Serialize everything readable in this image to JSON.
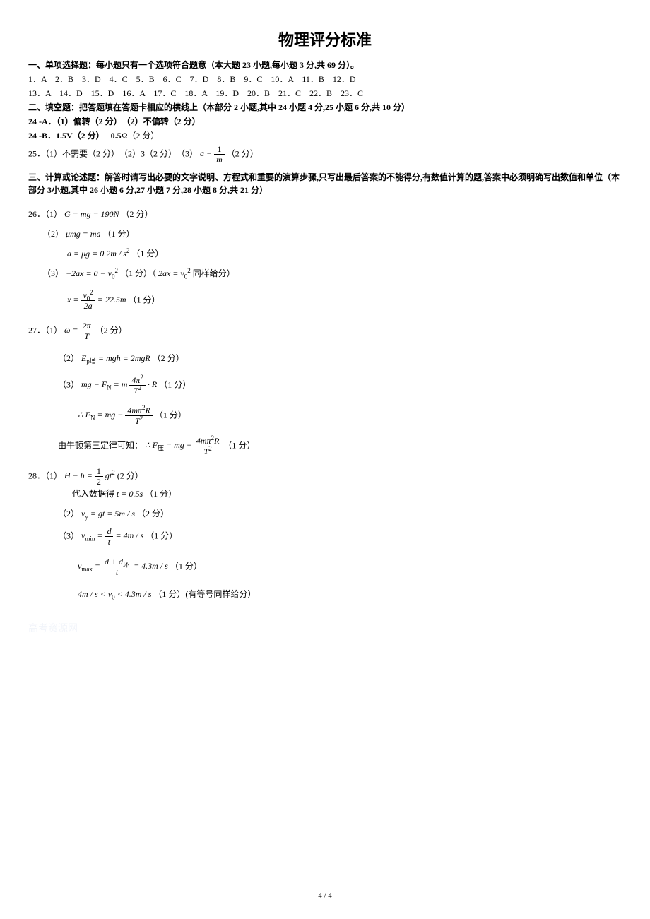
{
  "title": "物理评分标准",
  "section1": {
    "header": "一、单项选择题：每小题只有一个选项符合题意（本大题 23 小题,每小题 3 分,共 69 分）。",
    "row1": "1．A　2．B　3．D　4．C　5．B　6．C　7．D　8．B　9．C　10．A　11．B　12．D",
    "row2": "13．A　14．D　15．D　16．A　17．C　18．A　19．D　20．B　21．C　22．B　23．C"
  },
  "section2": {
    "header": "二、填空题：把答题填在答题卡相应的横线上（本部分 2 小题,其中 24 小题 4 分,25 小题 6 分,共 10 分）",
    "l24a": "24 -A．（1）偏转（2 分）　（2）不偏转（2 分）",
    "l24b_prefix": "24 -B．1.5V（2 分）　 0.5",
    "l24b_suffix": "（2 分）",
    "l25_prefix": "25．（1）不需要（2 分）　（2）3（2 分）　（3）",
    "l25_suffix": "（2 分）"
  },
  "section3": {
    "header": "三、计算或论述题：解答时请写出必要的文字说明、方程式和重要的演算步骤,只写出最后答案的不能得分,有数值计算的题,答案中必须明确写出数值和单位（本部分 3小题,其中 26 小题 6 分,27 小题 7 分,28 小题 8 分,共 21 分）"
  },
  "q26": {
    "p1_pre": "26．（1）",
    "p1_eq": "G = mg = 190N",
    "p1_pts": "（2 分）",
    "p2_pre": "（2）",
    "p2_eq": "μmg = ma",
    "p2_pts": "（1 分）",
    "p2b_eq_pre": "a = μg = 0.2m / s",
    "p2b_pts": "（1 分）",
    "p3_pre": "（3）",
    "p3_eq1_pre": "−2ax = 0 − v",
    "p3_pts1": "（1 分）（",
    "p3_eq2_pre": "2ax = v",
    "p3_suffix": "同样给分）",
    "p3b_pre": "x =",
    "p3b_frac_top": "v",
    "p3b_frac_bot": "2a",
    "p3b_eq_post": "= 22.5m",
    "p3b_pts": "（1 分）"
  },
  "q27": {
    "p1_pre": "27．（1）",
    "p1_eq_pre": "ω =",
    "p1_frac_top": "2π",
    "p1_frac_bot": "T",
    "p1_pts": "（2 分）",
    "p2_pre": "（2）",
    "p2_eq": "E",
    "p2_sub": "p增",
    "p2_eq2": " = mgh = 2mgR",
    "p2_pts": "（2 分）",
    "p3_pre": "（3）",
    "p3_eq_pre": "mg − F",
    "p3_sub": "N",
    "p3_eq_mid": " = m",
    "p3_frac_top": "4π",
    "p3_frac_bot": "T",
    "p3_eq_post": "· R",
    "p3_pts": "（1 分）",
    "p3b_pre": "∴ F",
    "p3b_sub": "N",
    "p3b_eq_mid": " = mg −",
    "p3b_frac_top": "4mπ",
    "p3b_frac_top2": "R",
    "p3b_frac_bot": "T",
    "p3b_pts": "（1 分）",
    "p3c_text": "由牛顿第三定律可知：",
    "p3c_eq_pre": "∴ F",
    "p3c_sub": "压",
    "p3c_eq_mid": " = mg −",
    "p3c_pts": "（1 分）"
  },
  "q28": {
    "p1_pre": "28．（1）",
    "p1_eq_pre": "H − h =",
    "p1_frac_top": "1",
    "p1_frac_bot": "2",
    "p1_eq_post": "gt",
    "p1_pts": "(2 分）",
    "p1b_text": "代入数据得",
    "p1b_eq": "t = 0.5s",
    "p1b_pts": "（1 分）",
    "p2_pre": "（2）",
    "p2_eq_pre": "v",
    "p2_sub": "y",
    "p2_eq_post": " = gt = 5m / s",
    "p2_pts": "（2 分）",
    "p3_pre": "（3）",
    "p3_eq_pre": "v",
    "p3_sub": "min",
    "p3_eq_mid": " =",
    "p3_frac_top": "d",
    "p3_frac_bot": "t",
    "p3_eq_post": "= 4m / s",
    "p3_pts": "（1 分）",
    "p3b_eq_pre": "v",
    "p3b_sub": "max",
    "p3b_eq_mid": " =",
    "p3b_frac_top_pre": "d + d",
    "p3b_frac_top_sub": "环",
    "p3b_frac_bot": "t",
    "p3b_eq_post": "= 4.3m / s",
    "p3b_pts": "（1 分）",
    "p3c_eq": "4m / s < v",
    "p3c_sub": "0",
    "p3c_eq2": " < 4.3m / s",
    "p3c_pts": "（1 分）(有等号同样给分）"
  },
  "footer": "4 / 4",
  "watermark": "高考资源网"
}
